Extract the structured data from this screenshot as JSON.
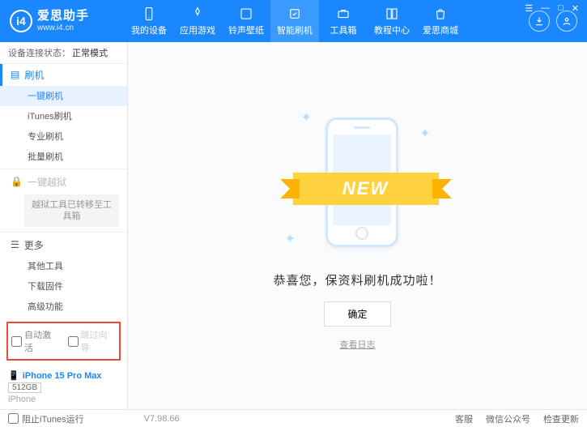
{
  "logo": {
    "title": "爱思助手",
    "sub": "www.i4.cn",
    "mark": "i4"
  },
  "nav": [
    {
      "label": "我的设备"
    },
    {
      "label": "应用游戏"
    },
    {
      "label": "铃声壁纸"
    },
    {
      "label": "智能刷机"
    },
    {
      "label": "工具箱"
    },
    {
      "label": "教程中心"
    },
    {
      "label": "爱思商城"
    }
  ],
  "status": {
    "prefix": "设备连接状态：",
    "value": "正常模式"
  },
  "side": {
    "flash": {
      "head": "刷机",
      "items": [
        "一键刷机",
        "iTunes刷机",
        "专业刷机",
        "批量刷机"
      ]
    },
    "jailbreak": {
      "head": "一键越狱",
      "note": "越狱工具已转移至工具箱"
    },
    "more": {
      "head": "更多",
      "items": [
        "其他工具",
        "下载固件",
        "高级功能"
      ]
    }
  },
  "checks": {
    "auto": "自动激活",
    "skip": "跳过向导"
  },
  "device": {
    "name": "iPhone 15 Pro Max",
    "storage": "512GB",
    "type": "iPhone"
  },
  "main": {
    "ribbon": "NEW",
    "success": "恭喜您，保资料刷机成功啦！",
    "ok": "确定",
    "log": "查看日志"
  },
  "statusbar": {
    "blockItunes": "阻止iTunes运行",
    "version": "V7.98.66",
    "links": [
      "客服",
      "微信公众号",
      "检查更新"
    ]
  }
}
